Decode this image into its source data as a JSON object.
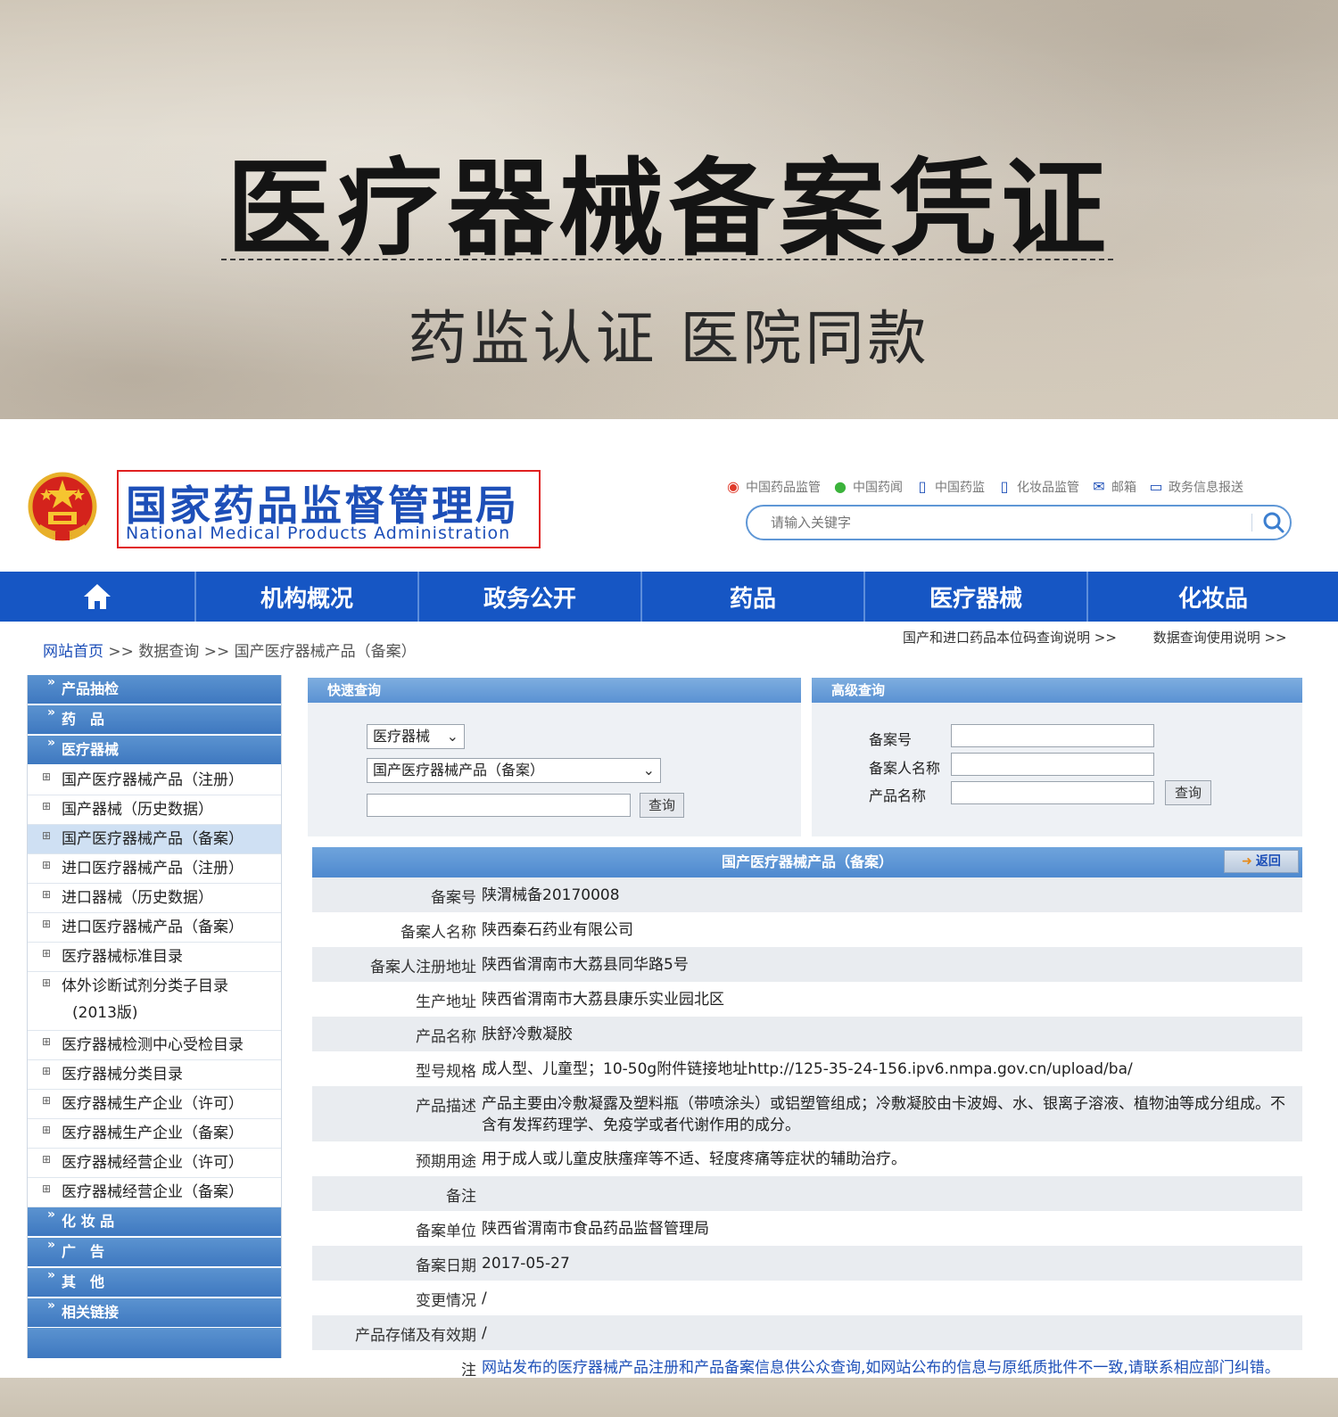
{
  "banner": {
    "title": "医疗器械备案凭证",
    "subtitle": "药监认证 医院同款"
  },
  "header": {
    "logo_cn": "国家药品监督管理局",
    "logo_en": "National Medical Products Administration",
    "top_links": [
      "中国药品监管",
      "中国药闻",
      "中国药监",
      "化妆品监管",
      "邮箱",
      "政务信息报送"
    ],
    "search_placeholder": "请输入关键字"
  },
  "nav": {
    "items": [
      "机构概况",
      "政务公开",
      "药品",
      "医疗器械",
      "化妆品"
    ]
  },
  "breadcrumb": {
    "home": "网站首页",
    "sep": ">>",
    "level2": "数据查询",
    "level3": "国产医疗器械产品（备案）"
  },
  "help_links": [
    "国产和进口药品本位码查询说明 >>",
    "数据查询使用说明 >>"
  ],
  "sidebar": {
    "sections": [
      "产品抽检",
      "药　品",
      "医疗器械",
      "化 妆 品",
      "广　告",
      "其　他",
      "相关链接"
    ],
    "device_items": [
      "国产医疗器械产品（注册）",
      "国产器械（历史数据）",
      "国产医疗器械产品（备案）",
      "进口医疗器械产品（注册）",
      "进口器械（历史数据）",
      "进口医疗器械产品（备案）",
      "医疗器械标准目录",
      "体外诊断试剂分类子目录",
      "(2013版)",
      "医疗器械检测中心受检目录",
      "医疗器械分类目录",
      "医疗器械生产企业（许可）",
      "医疗器械生产企业（备案）",
      "医疗器械经营企业（许可）",
      "医疗器械经营企业（备案）"
    ]
  },
  "quick_query": {
    "title": "快速查询",
    "category": "医疗器械",
    "database": "国产医疗器械产品（备案）",
    "button": "查询"
  },
  "advanced_query": {
    "title": "高级查询",
    "labels": [
      "备案号",
      "备案人名称",
      "产品名称"
    ],
    "button": "查询"
  },
  "result": {
    "title": "国产医疗器械产品（备案）",
    "back": "返回",
    "rows": [
      {
        "label": "备案号",
        "value": "陕渭械备20170008"
      },
      {
        "label": "备案人名称",
        "value": "陕西秦石药业有限公司"
      },
      {
        "label": "备案人注册地址",
        "value": "陕西省渭南市大荔县同华路5号"
      },
      {
        "label": "生产地址",
        "value": "陕西省渭南市大荔县康乐实业园北区"
      },
      {
        "label": "产品名称",
        "value": "肤舒冷敷凝胶"
      },
      {
        "label": "型号规格",
        "value": "成人型、儿童型；10-50g附件链接地址http://125-35-24-156.ipv6.nmpa.gov.cn/upload/ba/"
      },
      {
        "label": "产品描述",
        "value": "产品主要由冷敷凝露及塑料瓶（带喷涂头）或铝塑管组成；冷敷凝胶由卡波姆、水、银离子溶液、植物油等成分组成。不含有发挥药理学、免疫学或者代谢作用的成分。"
      },
      {
        "label": "预期用途",
        "value": "用于成人或儿童皮肤瘙痒等不适、轻度疼痛等症状的辅助治疗。"
      },
      {
        "label": "备注",
        "value": ""
      },
      {
        "label": "备案单位",
        "value": "陕西省渭南市食品药品监督管理局"
      },
      {
        "label": "备案日期",
        "value": "2017-05-27"
      },
      {
        "label": "变更情况",
        "value": "/"
      },
      {
        "label": "产品存储及有效期",
        "value": "/"
      },
      {
        "label": "注",
        "value": "网站发布的医疗器械产品注册和产品备案信息供公众查询,如网站公布的信息与原纸质批件不一致,请联系相应部门纠错。进口和国产三类医疗器械数据问题请发送邮件至国家药监局医疗器械数据纠错邮箱："
      }
    ]
  },
  "colors": {
    "nav_blue": "#1656c4",
    "logo_red": "#e02020",
    "link_blue": "#1d4fb8",
    "sidebar_head": "#4a84c8"
  }
}
